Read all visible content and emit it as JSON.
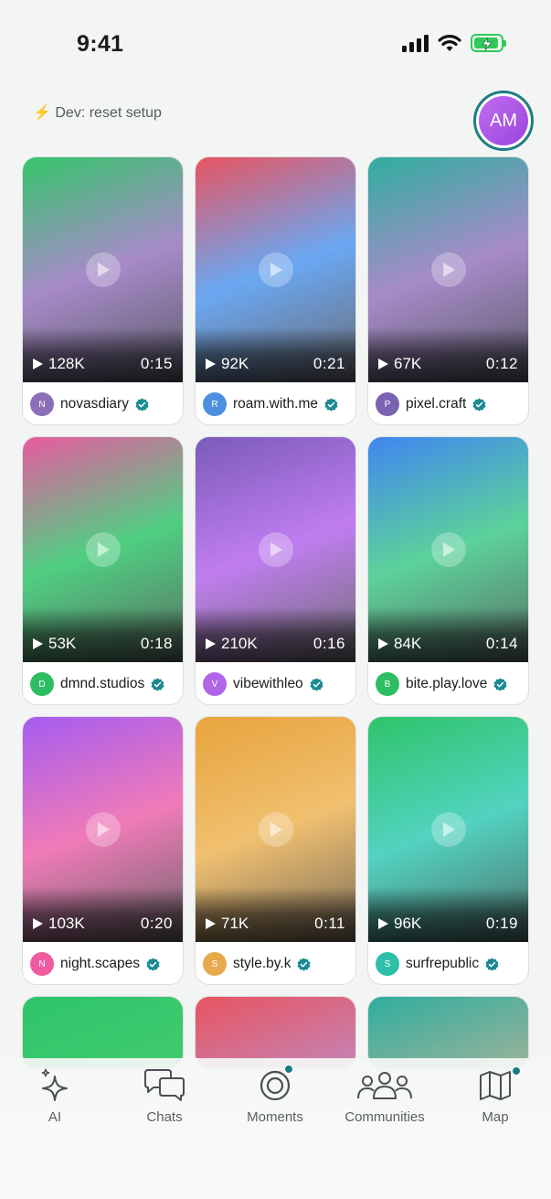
{
  "status_bar": {
    "time": "9:41"
  },
  "header": {
    "dev_link": "⚡ Dev: reset setup",
    "avatar_initials": "AM"
  },
  "videos": [
    {
      "views": "128K",
      "duration": "0:15",
      "username": "novasdiary",
      "initial": "N",
      "avatar_color": "#8a6fb8",
      "gradient": [
        "#34c56a",
        "#a78bc9",
        "#5a5a66"
      ]
    },
    {
      "views": "92K",
      "duration": "0:21",
      "username": "roam.with.me",
      "initial": "R",
      "avatar_color": "#4c8fe0",
      "gradient": [
        "#e85460",
        "#6aa8f2",
        "#6a6a72"
      ]
    },
    {
      "views": "67K",
      "duration": "0:12",
      "username": "pixel.craft",
      "initial": "P",
      "avatar_color": "#7a63b2",
      "gradient": [
        "#2fae9e",
        "#a78bc9",
        "#5a5a66"
      ]
    },
    {
      "views": "53K",
      "duration": "0:18",
      "username": "dmnd.studios",
      "initial": "D",
      "avatar_color": "#2dbd63",
      "gradient": [
        "#e85aa0",
        "#4fcf82",
        "#5b6e62"
      ]
    },
    {
      "views": "210K",
      "duration": "0:16",
      "username": "vibewithleo",
      "initial": "V",
      "avatar_color": "#b066e8",
      "gradient": [
        "#7a5bb8",
        "#c07df0",
        "#6e6e70"
      ]
    },
    {
      "views": "84K",
      "duration": "0:14",
      "username": "bite.play.love",
      "initial": "B",
      "avatar_color": "#2dbd63",
      "gradient": [
        "#3f86f0",
        "#5cd29a",
        "#5a6e66"
      ]
    },
    {
      "views": "103K",
      "duration": "0:20",
      "username": "night.scapes",
      "initial": "N",
      "avatar_color": "#ef5aa0",
      "gradient": [
        "#a55cf0",
        "#f07bb8",
        "#6a6468"
      ]
    },
    {
      "views": "71K",
      "duration": "0:11",
      "username": "style.by.k",
      "initial": "S",
      "avatar_color": "#e8a84c",
      "gradient": [
        "#e8a43c",
        "#f0c070",
        "#7a6c5a"
      ]
    },
    {
      "views": "96K",
      "duration": "0:19",
      "username": "surfrepublic",
      "initial": "S",
      "avatar_color": "#2fbfa8",
      "gradient": [
        "#2ec46a",
        "#52d3c0",
        "#4e6e6a"
      ]
    },
    {
      "gradient": [
        "#2ec46a",
        "#44cc70",
        "#6ad088"
      ]
    },
    {
      "gradient": [
        "#e85460",
        "#c08abf",
        "#a4a0c8"
      ]
    },
    {
      "gradient": [
        "#2fae9e",
        "#a6b39a",
        "#f0c068"
      ]
    }
  ],
  "nav": [
    {
      "label": "AI",
      "icon": "sparkle-icon"
    },
    {
      "label": "Chats",
      "icon": "chat-bubbles-icon"
    },
    {
      "label": "Moments",
      "icon": "moments-ring-icon"
    },
    {
      "label": "Communities",
      "icon": "people-group-icon"
    },
    {
      "label": "Map",
      "icon": "map-icon"
    }
  ],
  "colors": {
    "accent": "#1b7b83",
    "verified": "#1b8a94",
    "background": "#f3f5f4"
  }
}
